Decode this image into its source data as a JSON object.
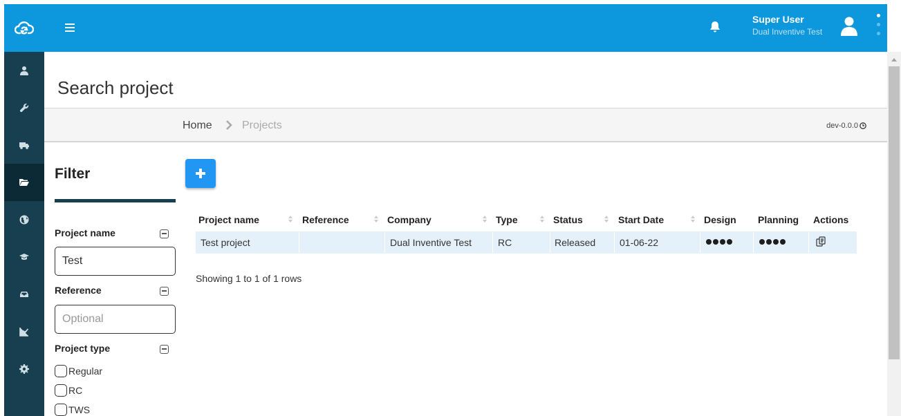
{
  "topbar": {
    "user_name": "Super User",
    "user_org": "Dual Inventive Test"
  },
  "sidebar": {
    "items": [
      {
        "icon": "user-icon"
      },
      {
        "icon": "wrench-icon"
      },
      {
        "icon": "truck-icon"
      },
      {
        "icon": "folder-open-icon",
        "active": true
      },
      {
        "icon": "globe-icon"
      },
      {
        "icon": "graduation-cap-icon"
      },
      {
        "icon": "inbox-icon"
      },
      {
        "icon": "line-chart-icon"
      },
      {
        "icon": "cog-icon"
      }
    ]
  },
  "page": {
    "title": "Search project",
    "breadcrumb": {
      "home": "Home",
      "current": "Projects"
    },
    "version": "dev-0.0.0"
  },
  "filter": {
    "title": "Filter",
    "project_name_label": "Project name",
    "project_name_value": "Test",
    "reference_label": "Reference",
    "reference_placeholder": "Optional",
    "project_type_label": "Project type",
    "project_types": [
      "Regular",
      "RC",
      "TWS"
    ]
  },
  "table": {
    "columns": [
      "Project name",
      "Reference",
      "Company",
      "Type",
      "Status",
      "Start Date",
      "Design",
      "Planning",
      "Actions"
    ],
    "rows": [
      {
        "project_name": "Test project",
        "reference": "",
        "company": "Dual Inventive Test",
        "type": "RC",
        "status": "Released",
        "start_date": "01-06-22"
      }
    ],
    "pager_text": "Showing 1 to 1 of 1 rows"
  },
  "colors": {
    "brand_blue": "#0d97dc",
    "sidebar_dark": "#183f4f",
    "add_button": "#2196f3",
    "row_highlight": "#e4f0fa"
  }
}
